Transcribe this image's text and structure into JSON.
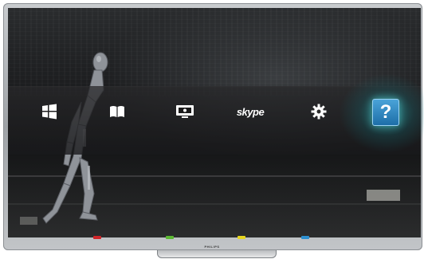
{
  "menu": {
    "items": [
      {
        "name": "home",
        "icon": "home-windows-icon"
      },
      {
        "name": "browse",
        "icon": "book-icon"
      },
      {
        "name": "tv",
        "icon": "monitor-icon"
      },
      {
        "name": "skype",
        "icon": "skype-icon",
        "label": "skype"
      },
      {
        "name": "setup",
        "icon": "gear-icon"
      },
      {
        "name": "help",
        "icon": "question-icon",
        "label": "?"
      }
    ],
    "selected": "help",
    "accent_color": "#2fc4c8"
  },
  "color_keys": [
    {
      "name": "red",
      "color": "#d0262a"
    },
    {
      "name": "green",
      "color": "#5bb833"
    },
    {
      "name": "yellow",
      "color": "#e5d51f"
    },
    {
      "name": "blue",
      "color": "#2d8fd0"
    }
  ],
  "brand": {
    "text": "PHILIPS"
  }
}
